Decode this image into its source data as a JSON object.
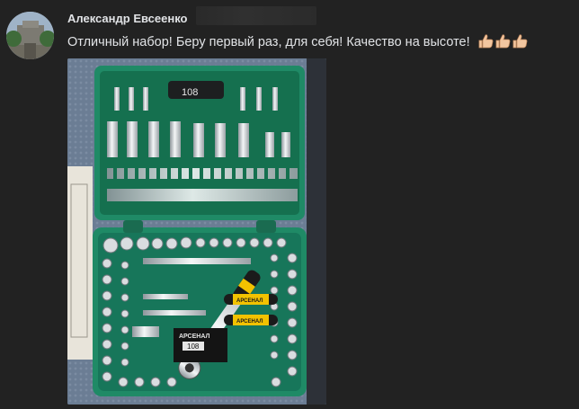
{
  "author": {
    "name": "Александр Евсеенко"
  },
  "review": {
    "text": "Отличный набор! Беру первый раз, для себя! Качество на высоте!"
  },
  "icons": {
    "reaction": "thumbs-up-icon",
    "avatar": "user-avatar"
  },
  "photo": {
    "case_badge": "108",
    "brand": "АРСЕНАЛ",
    "card_title": "АРСЕНАЛ",
    "card_badge": "108"
  },
  "colors": {
    "case_green": "#1f8a66",
    "background": "#222222",
    "text": "#e1e3e6"
  }
}
